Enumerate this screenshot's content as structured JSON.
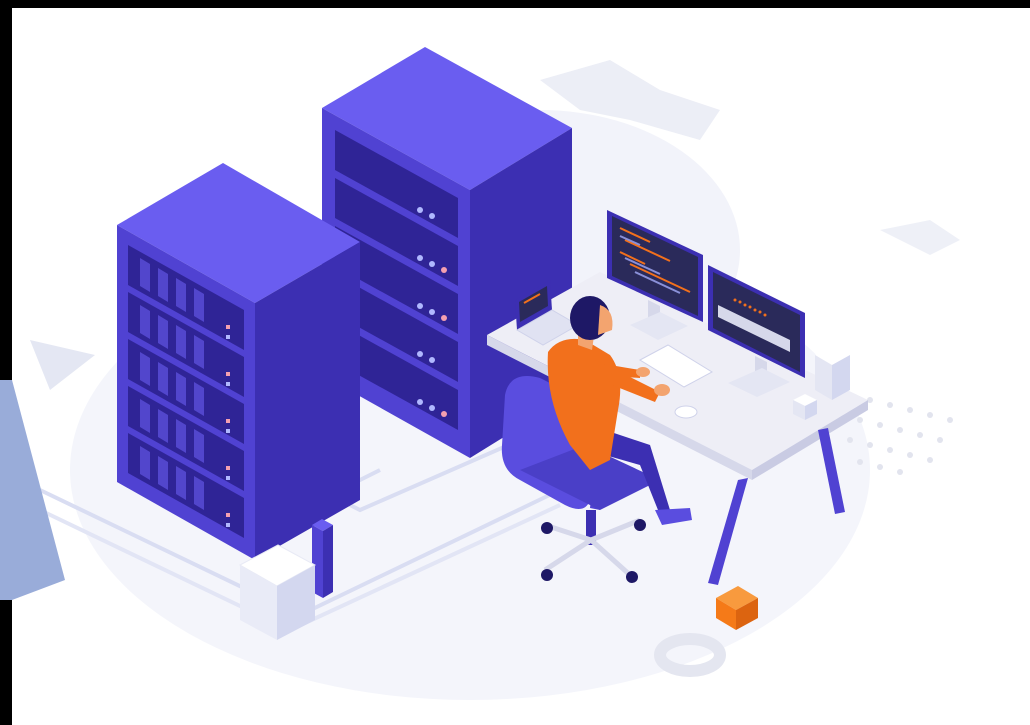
{
  "scene": {
    "subject": "isometric-server-room-developer-illustration",
    "colors": {
      "background": "#ffffff",
      "left_strip": "#000000",
      "accent_triangle": "#99acd9",
      "server_top": "#6a5df0",
      "server_left": "#5042d2",
      "server_right": "#3c2fb2",
      "server_unit": "#2f2496",
      "desk_top": "#eeeef6",
      "shirt": "#f2701c",
      "hair": "#1e1866",
      "skin": "#f3a46f",
      "chair": "#5a4ddf",
      "monitor_screen": "#2a2a5a",
      "code_line": "#f2701c",
      "orange_cube": "#f57a18",
      "led_pink": "#f4a0b0",
      "led_blue": "#b0b8ff"
    },
    "icons": [
      "server-rack-icon",
      "monitor-icon",
      "laptop-icon",
      "keyboard-icon",
      "mouse-icon",
      "office-chair-icon",
      "cube-icon"
    ]
  }
}
